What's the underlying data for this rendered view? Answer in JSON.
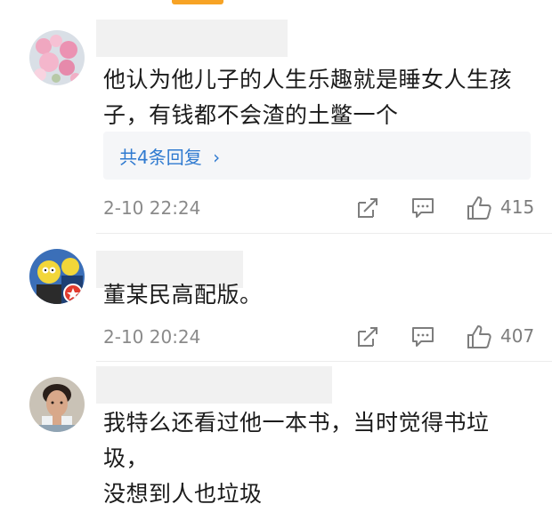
{
  "comments": [
    {
      "text_line1": "他认为他儿子的人生乐趣就是睡女人生孩",
      "text_line2": "子，有钱都不会渣的土鳖一个",
      "reply_link": "共4条回复",
      "reply_chevron": "›",
      "timestamp": "2-10 22:24",
      "like_count": "415"
    },
    {
      "text_line1": "董某民高配版。",
      "timestamp": "2-10 20:24",
      "like_count": "407"
    },
    {
      "text_line1": "我特么还看过他一本书，当时觉得书垃圾，",
      "text_line2": "没想到人也垃圾"
    }
  ],
  "icons": {
    "share": "share-icon",
    "comment": "comment-icon",
    "like": "thumbs-up-icon"
  },
  "colors": {
    "accent_tab": "#f7a325",
    "reply_link": "#2f7ad0",
    "meta_text": "#8a8a8a"
  }
}
